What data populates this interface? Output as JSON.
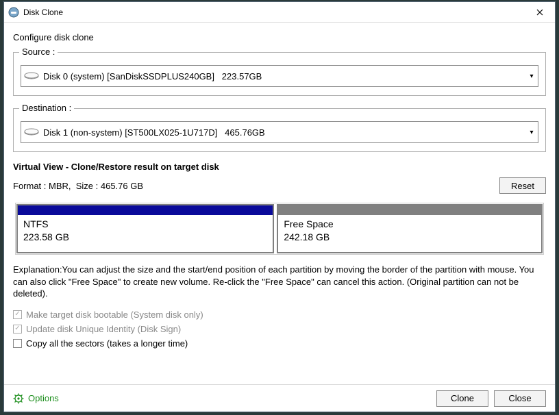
{
  "window": {
    "title": "Disk Clone"
  },
  "configure_label": "Configure disk clone",
  "source": {
    "legend": "Source :",
    "selected": "Disk 0 (system) [SanDiskSSDPLUS240GB]   223.57GB"
  },
  "destination": {
    "legend": "Destination :",
    "selected": "Disk 1 (non-system) [ST500LX025-1U717D]   465.76GB"
  },
  "virtual_view": {
    "heading_bold": "Virtual View",
    "heading_rest": " - Clone/Restore result on target disk",
    "format_line": "Format : MBR,  Size : 465.76 GB",
    "reset_label": "Reset",
    "partitions": [
      {
        "name": "NTFS",
        "size": "223.58 GB"
      },
      {
        "name": "Free Space",
        "size": "242.18 GB"
      }
    ]
  },
  "explanation": "Explanation:You can adjust the size and the start/end position of each partition by moving the border of the partition with mouse. You can also click \"Free Space\" to create new volume. Re-click the \"Free Space\" can cancel this action. (Original partition can not be deleted).",
  "checks": {
    "bootable": "Make target disk bootable (System disk only)",
    "unique": "Update disk Unique Identity (Disk Sign)",
    "allsectors": "Copy all the sectors (takes a longer time)"
  },
  "footer": {
    "options": "Options",
    "clone": "Clone",
    "close": "Close"
  }
}
